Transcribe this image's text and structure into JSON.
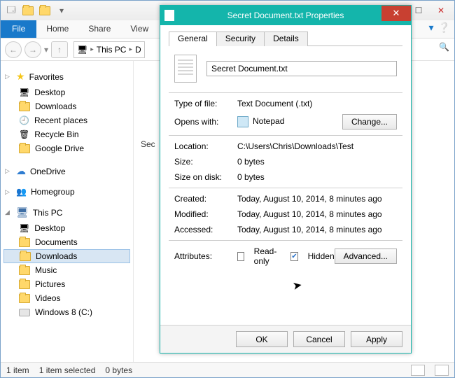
{
  "explorer": {
    "ribbon": {
      "file": "File",
      "home": "Home",
      "share": "Share",
      "view": "View"
    },
    "breadcrumb": {
      "root": "This PC",
      "next": "D"
    },
    "nav": {
      "favorites": {
        "label": "Favorites",
        "items": [
          "Desktop",
          "Downloads",
          "Recent places",
          "Recycle Bin",
          "Google Drive"
        ]
      },
      "onedrive": "OneDrive",
      "homegroup": "Homegroup",
      "thispc": {
        "label": "This PC",
        "items": [
          "Desktop",
          "Documents",
          "Downloads",
          "Music",
          "Pictures",
          "Videos",
          "Windows 8 (C:)"
        ]
      }
    },
    "content_visible": "Sec",
    "status": {
      "items": "1 item",
      "selected": "1 item selected",
      "size": "0 bytes"
    }
  },
  "dialog": {
    "title": "Secret Document.txt Properties",
    "tabs": {
      "general": "General",
      "security": "Security",
      "details": "Details"
    },
    "filename": "Secret Document.txt",
    "rows": {
      "typeoffile_k": "Type of file:",
      "typeoffile_v": "Text Document (.txt)",
      "openswith_k": "Opens with:",
      "openswith_v": "Notepad",
      "change": "Change...",
      "location_k": "Location:",
      "location_v": "C:\\Users\\Chris\\Downloads\\Test",
      "size_k": "Size:",
      "size_v": "0 bytes",
      "sizeondisk_k": "Size on disk:",
      "sizeondisk_v": "0 bytes",
      "created_k": "Created:",
      "created_v": "Today, August 10, 2014, 8 minutes ago",
      "modified_k": "Modified:",
      "modified_v": "Today, August 10, 2014, 8 minutes ago",
      "accessed_k": "Accessed:",
      "accessed_v": "Today, August 10, 2014, 8 minutes ago",
      "attributes_k": "Attributes:",
      "readonly": "Read-only",
      "hidden": "Hidden",
      "advanced": "Advanced..."
    },
    "buttons": {
      "ok": "OK",
      "cancel": "Cancel",
      "apply": "Apply"
    }
  }
}
